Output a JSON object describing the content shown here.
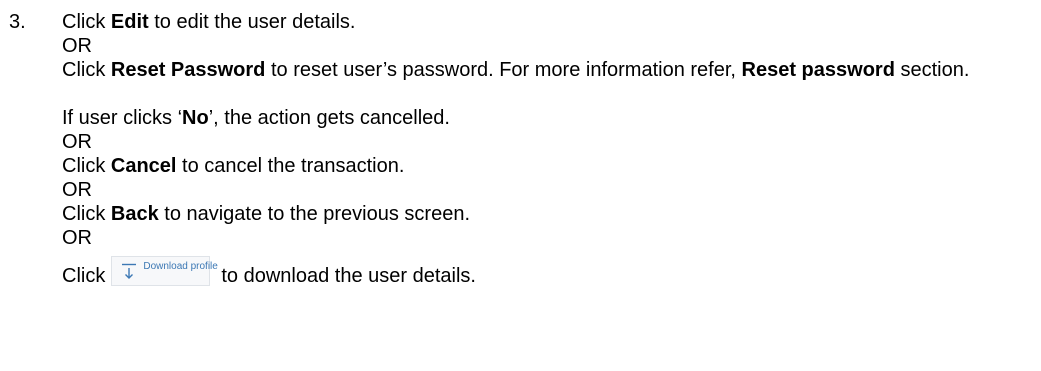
{
  "step": {
    "number": "3.",
    "line1": {
      "prefix": "Click ",
      "bold": "Edit",
      "suffix": " to edit the user details."
    },
    "or1": "OR",
    "line2": {
      "prefix": "Click ",
      "bold1": "Reset Password",
      "middle": " to reset user’s password. For more information refer, ",
      "bold2": "Reset password",
      "suffix": " section."
    },
    "line3": {
      "prefix": " If user clicks ‘",
      "bold": "No",
      "suffix": "’, the action gets cancelled."
    },
    "or2": "OR",
    "line4": {
      "prefix": "Click ",
      "bold": "Cancel",
      "suffix": " to cancel the transaction."
    },
    "or3": "OR",
    "line5": {
      "prefix": "Click ",
      "bold": "Back",
      "suffix": " to navigate to the previous screen."
    },
    "or4": "OR",
    "line6": {
      "prefix": "Click",
      "button_label": "Download profile",
      "button_icon": "download-icon",
      "suffix": "to download the user details."
    }
  }
}
